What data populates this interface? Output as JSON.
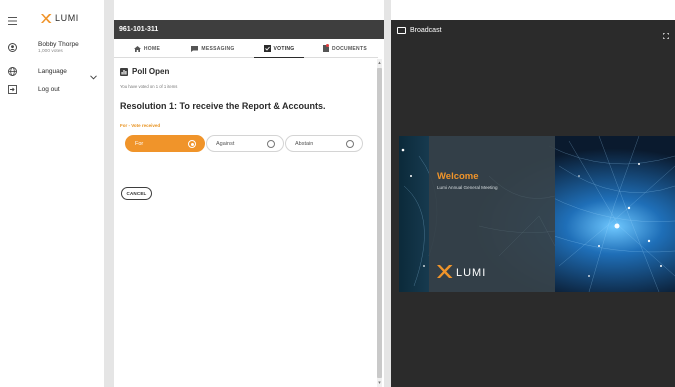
{
  "sidebar": {
    "brand": "LUMI",
    "user_name": "Bobby Thorpe",
    "user_votes": "1,000 votes",
    "language_label": "Language",
    "logout_label": "Log out"
  },
  "main": {
    "header_title": "961-101-311",
    "tabs": [
      {
        "label": "HOME",
        "icon": "home-icon"
      },
      {
        "label": "MESSAGING",
        "icon": "messaging-icon"
      },
      {
        "label": "VOTING",
        "icon": "voting-icon",
        "active": true
      },
      {
        "label": "DOCUMENTS",
        "icon": "documents-icon",
        "badge": true
      }
    ],
    "poll_title": "Poll Open",
    "voted_note": "You have voted on 1 of 1 items",
    "resolution": "Resolution 1: To receive the Report & Accounts.",
    "vote_received": "For - Vote received",
    "options": [
      {
        "label": "For",
        "selected": true
      },
      {
        "label": "Against",
        "selected": false
      },
      {
        "label": "Abstain",
        "selected": false
      }
    ],
    "cancel_label": "CANCEL"
  },
  "broadcast": {
    "title": "Broadcast",
    "slide_title": "Welcome",
    "slide_subtitle": "Lumi Annual General Meeting",
    "slide_brand": "LUMI"
  },
  "colors": {
    "accent": "#f0942a",
    "header_dark": "#3e3e3e",
    "broadcast_bg": "#2b2b2b"
  }
}
